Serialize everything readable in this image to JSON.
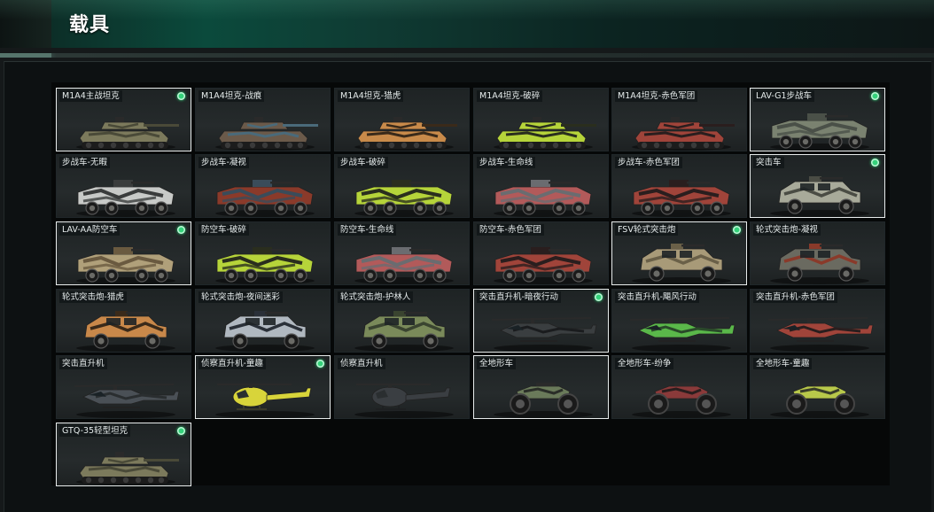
{
  "header": {
    "title": "载具"
  },
  "vehicles": [
    {
      "label": "M1A4主战坦克",
      "kind": "tank",
      "c1": "#7c7a5c",
      "c2": "#4a4a38",
      "selected": true,
      "badge": true
    },
    {
      "label": "M1A4坦克-战痕",
      "kind": "tank",
      "c1": "#6b5a4a",
      "c2": "#4a6a7a",
      "selected": false,
      "badge": false
    },
    {
      "label": "M1A4坦克-猎虎",
      "kind": "tank",
      "c1": "#c88a4a",
      "c2": "#3a2a1a",
      "selected": false,
      "badge": false
    },
    {
      "label": "M1A4坦克-破碎",
      "kind": "tank",
      "c1": "#b6d43a",
      "c2": "#2a2e1e",
      "selected": false,
      "badge": false
    },
    {
      "label": "M1A4坦克-赤色军团",
      "kind": "tank",
      "c1": "#a0443a",
      "c2": "#2a1e1e",
      "selected": false,
      "badge": false
    },
    {
      "label": "LAV-G1步战车",
      "kind": "ifv",
      "c1": "#7a8270",
      "c2": "#4a5048",
      "selected": true,
      "badge": true
    },
    {
      "label": "步战车-无暇",
      "kind": "ifv",
      "c1": "#c8cac8",
      "c2": "#3a3c3c",
      "selected": false,
      "badge": false
    },
    {
      "label": "步战车-凝视",
      "kind": "ifv",
      "c1": "#8a3a2a",
      "c2": "#3a4c5a",
      "selected": false,
      "badge": false
    },
    {
      "label": "步战车-破碎",
      "kind": "ifv",
      "c1": "#b6d43a",
      "c2": "#2a2e1e",
      "selected": false,
      "badge": false
    },
    {
      "label": "步战车-生命线",
      "kind": "ifv",
      "c1": "#b25a5a",
      "c2": "#6a6c70",
      "selected": false,
      "badge": false
    },
    {
      "label": "步战车-赤色军团",
      "kind": "ifv",
      "c1": "#a0443a",
      "c2": "#2a1e1e",
      "selected": false,
      "badge": false
    },
    {
      "label": "突击车",
      "kind": "truck",
      "c1": "#a8aa9a",
      "c2": "#4a4c44",
      "selected": true,
      "badge": true
    },
    {
      "label": "LAV-AA防空车",
      "kind": "ifv",
      "c1": "#b0a07a",
      "c2": "#6a5a40",
      "selected": true,
      "badge": true
    },
    {
      "label": "防空车-破碎",
      "kind": "ifv",
      "c1": "#b6d43a",
      "c2": "#2a2e1e",
      "selected": false,
      "badge": false
    },
    {
      "label": "防空车-生命线",
      "kind": "ifv",
      "c1": "#b25a5a",
      "c2": "#6a6c70",
      "selected": false,
      "badge": false
    },
    {
      "label": "防空车-赤色军团",
      "kind": "ifv",
      "c1": "#a0443a",
      "c2": "#2a1e1e",
      "selected": false,
      "badge": false
    },
    {
      "label": "FSV轮式突击炮",
      "kind": "truck",
      "c1": "#a89a78",
      "c2": "#6a6048",
      "selected": true,
      "badge": true
    },
    {
      "label": "轮式突击炮-凝视",
      "kind": "truck",
      "c1": "#6a6a60",
      "c2": "#8a3a2a",
      "selected": false,
      "badge": false
    },
    {
      "label": "轮式突击炮-猎虎",
      "kind": "truck",
      "c1": "#c8884a",
      "c2": "#3a2a1a",
      "selected": false,
      "badge": false
    },
    {
      "label": "轮式突击炮-夜间迷彩",
      "kind": "truck",
      "c1": "#b0b8c0",
      "c2": "#2a3038",
      "selected": false,
      "badge": false
    },
    {
      "label": "轮式突击炮-护林人",
      "kind": "truck",
      "c1": "#7a8a5a",
      "c2": "#3a4430",
      "selected": false,
      "badge": false
    },
    {
      "label": "突击直升机-暗夜行动",
      "kind": "heli",
      "c1": "#3a3e40",
      "c2": "#1a1c1e",
      "selected": true,
      "badge": true
    },
    {
      "label": "突击直升机-飓风行动",
      "kind": "heli",
      "c1": "#5ab84a",
      "c2": "#2a4a2a",
      "selected": false,
      "badge": false
    },
    {
      "label": "突击直升机-赤色军团",
      "kind": "heli",
      "c1": "#a0443a",
      "c2": "#2a1e1e",
      "selected": false,
      "badge": false
    },
    {
      "label": "突击直升机",
      "kind": "heli",
      "c1": "#4a5056",
      "c2": "#2a2e30",
      "selected": false,
      "badge": false
    },
    {
      "label": "侦察直升机-童趣",
      "kind": "smallheli",
      "c1": "#d8d43a",
      "c2": "#3a3a2a",
      "selected": true,
      "badge": true
    },
    {
      "label": "侦察直升机",
      "kind": "smallheli",
      "c1": "#3a3e42",
      "c2": "#1e2022",
      "selected": false,
      "badge": false
    },
    {
      "label": "全地形车",
      "kind": "atv",
      "c1": "#6a7a5a",
      "c2": "#2a2e28",
      "selected": true,
      "badge": false
    },
    {
      "label": "全地形车-纷争",
      "kind": "atv",
      "c1": "#8a3a3a",
      "c2": "#2a1e1e",
      "selected": false,
      "badge": false
    },
    {
      "label": "全地形车-童趣",
      "kind": "atv",
      "c1": "#b8c84a",
      "c2": "#3a3e2a",
      "selected": false,
      "badge": false
    },
    {
      "label": "GTQ-35轻型坦克",
      "kind": "tank",
      "c1": "#7c7a5c",
      "c2": "#4a4a38",
      "selected": true,
      "badge": true
    }
  ]
}
